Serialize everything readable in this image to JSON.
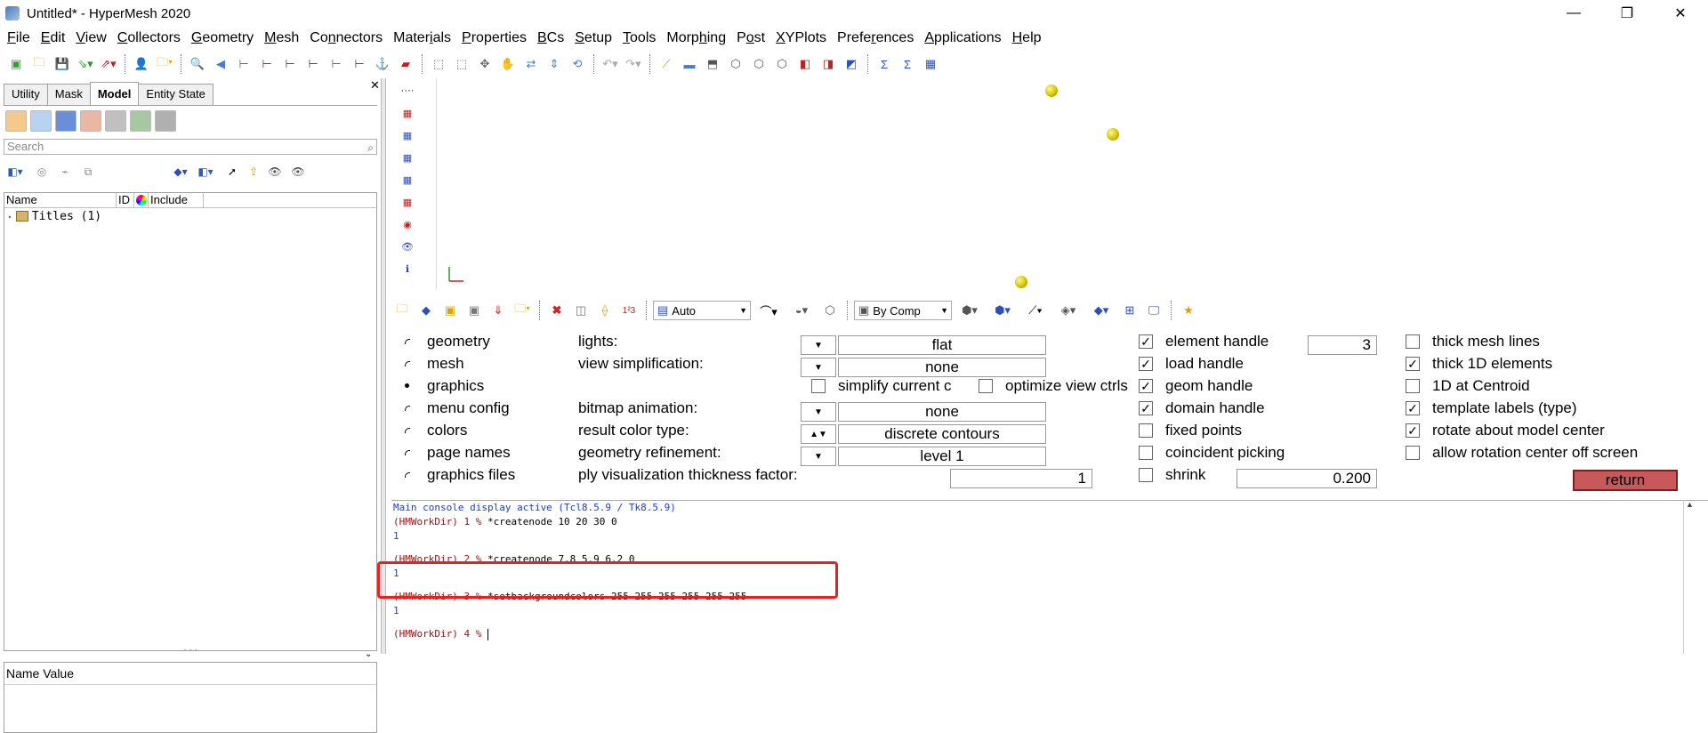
{
  "window": {
    "title": "Untitled* - HyperMesh 2020",
    "minimize": "—",
    "maximize": "❐",
    "close": "✕"
  },
  "menu": [
    {
      "pre": "",
      "u": "F",
      "post": "ile"
    },
    {
      "pre": "",
      "u": "E",
      "post": "dit"
    },
    {
      "pre": "",
      "u": "V",
      "post": "iew"
    },
    {
      "pre": "",
      "u": "C",
      "post": "ollectors"
    },
    {
      "pre": "",
      "u": "G",
      "post": "eometry"
    },
    {
      "pre": "",
      "u": "M",
      "post": "esh"
    },
    {
      "pre": "Co",
      "u": "n",
      "post": "nectors"
    },
    {
      "pre": "Mater",
      "u": "i",
      "post": "als"
    },
    {
      "pre": "",
      "u": "P",
      "post": "roperties"
    },
    {
      "pre": "",
      "u": "B",
      "post": "Cs"
    },
    {
      "pre": "",
      "u": "S",
      "post": "etup"
    },
    {
      "pre": "",
      "u": "T",
      "post": "ools"
    },
    {
      "pre": "Morp",
      "u": "h",
      "post": "ing"
    },
    {
      "pre": "P",
      "u": "o",
      "post": "st"
    },
    {
      "pre": "",
      "u": "X",
      "post": "YPlots"
    },
    {
      "pre": "Prefe",
      "u": "r",
      "post": "ences"
    },
    {
      "pre": "",
      "u": "A",
      "post": "pplications"
    },
    {
      "pre": "",
      "u": "H",
      "post": "elp"
    }
  ],
  "left_panel": {
    "tabs": [
      "Utility",
      "Mask",
      "Model",
      "Entity State"
    ],
    "active_tab": "Model",
    "close": "✕",
    "search_placeholder": "Search",
    "columns": [
      "Name",
      "ID",
      "Include"
    ],
    "tree": [
      {
        "label": "Titles (1)"
      }
    ],
    "splitter": "· · ·",
    "props_header": "Name Value"
  },
  "graphics_toolbar": {
    "auto_dd": "Auto",
    "bycomp_dd": "By Comp"
  },
  "panel": {
    "radios": [
      {
        "label": "geometry",
        "selected": false
      },
      {
        "label": "mesh",
        "selected": false
      },
      {
        "label": "graphics",
        "selected": true
      },
      {
        "label": "menu config",
        "selected": false
      },
      {
        "label": "colors",
        "selected": false
      },
      {
        "label": "page names",
        "selected": false
      },
      {
        "label": "graphics files",
        "selected": false
      }
    ],
    "lights_label": "lights:",
    "lights_value": "flat",
    "viewsimp_label": "view simplification:",
    "viewsimp_value": "none",
    "simplify_label": "simplify current c",
    "optimize_label": "optimize view ctrls",
    "bitmap_label": "bitmap animation:",
    "bitmap_value": "none",
    "resultcolor_label": "result color type:",
    "resultcolor_value": "discrete contours",
    "georef_label": "geometry refinement:",
    "georef_value": "level  1",
    "ply_label": "ply visualization thickness factor:",
    "ply_value": "1",
    "col3": [
      {
        "label": "element handle",
        "checked": true
      },
      {
        "label": "load handle",
        "checked": true
      },
      {
        "label": "geom handle",
        "checked": true
      },
      {
        "label": "domain handle",
        "checked": true
      },
      {
        "label": "fixed points",
        "checked": false
      },
      {
        "label": "coincident picking",
        "checked": false
      },
      {
        "label": "shrink",
        "checked": false
      }
    ],
    "element_handle_value": "3",
    "shrink_value": "0.200",
    "col4": [
      {
        "label": "thick mesh lines",
        "checked": false
      },
      {
        "label": "thick 1D elements",
        "checked": true
      },
      {
        "label": "1D at Centroid",
        "checked": false
      },
      {
        "label": "template labels (type)",
        "checked": true
      },
      {
        "label": "rotate about model center",
        "checked": true
      },
      {
        "label": "allow rotation center off screen",
        "checked": false
      }
    ],
    "return_label": "return"
  },
  "console": [
    {
      "cls": "blue",
      "text": "Main console display active (Tcl8.5.9 / Tk8.5.9)"
    },
    {
      "cls": "red",
      "text": "(HMWorkDir) 1 % ",
      "cmd": "*createnode 10 20 30 0"
    },
    {
      "cls": "blue",
      "text": "1"
    },
    {
      "cls": "red",
      "text": "(HMWorkDir) 2 % ",
      "cmd": "*createnode 7.8 5.9 6.2 0"
    },
    {
      "cls": "blue",
      "text": "1"
    },
    {
      "cls": "red",
      "text": "(HMWorkDir) 3 % ",
      "cmd": "*setbackgroundcolors 255 255 255 255 255 255"
    },
    {
      "cls": "blue",
      "text": "1"
    },
    {
      "cls": "red",
      "text": "(HMWorkDir) 4 % ",
      "cmd": ""
    }
  ],
  "colors": {
    "return_bg": "#c8595a",
    "highlight": "#e82020",
    "node": "#e0cd00"
  }
}
